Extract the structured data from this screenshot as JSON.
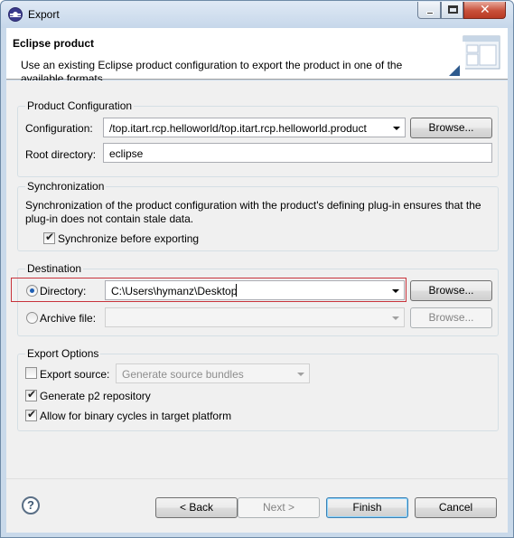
{
  "window": {
    "title": "Export",
    "icon": "eclipse-icon",
    "controls": {
      "minimize": "minimize-icon",
      "maximize": "maximize-icon",
      "close": "close-icon",
      "close_glyph": "✕"
    }
  },
  "banner": {
    "title": "Eclipse product",
    "description": "Use an existing Eclipse product configuration to export the product in one of the available formats."
  },
  "product_configuration": {
    "group_label": "Product Configuration",
    "configuration_label": "Configuration:",
    "configuration_value": "/top.itart.rcp.helloworld/top.itart.rcp.helloworld.product",
    "browse_label": "Browse...",
    "root_directory_label": "Root directory:",
    "root_directory_value": "eclipse"
  },
  "synchronization": {
    "group_label": "Synchronization",
    "description": "Synchronization of the product configuration with the product's defining plug-in ensures that the plug-in does not contain stale data.",
    "checkbox_label": "Synchronize before exporting",
    "checked": true
  },
  "destination": {
    "group_label": "Destination",
    "directory_label": "Directory:",
    "directory_value": "C:\\Users\\hymanz\\Desktop",
    "directory_selected": true,
    "browse_label": "Browse...",
    "archive_label": "Archive file:",
    "archive_value": "",
    "archive_browse_label": "Browse..."
  },
  "export_options": {
    "group_label": "Export Options",
    "export_source_label": "Export source:",
    "export_source_checked": false,
    "source_option": "Generate source bundles",
    "p2_label": "Generate p2 repository",
    "p2_checked": true,
    "binary_cycles_label": "Allow for binary cycles in target platform",
    "binary_cycles_checked": true
  },
  "footer": {
    "help_glyph": "?",
    "back_label": "< Back",
    "next_label": "Next >",
    "finish_label": "Finish",
    "cancel_label": "Cancel"
  },
  "colors": {
    "window_frame": "#c9d9ea",
    "dialog_background": "#f0f0f0",
    "focus_border": "#c8333b",
    "radio_dot": "#1f5fb4"
  }
}
